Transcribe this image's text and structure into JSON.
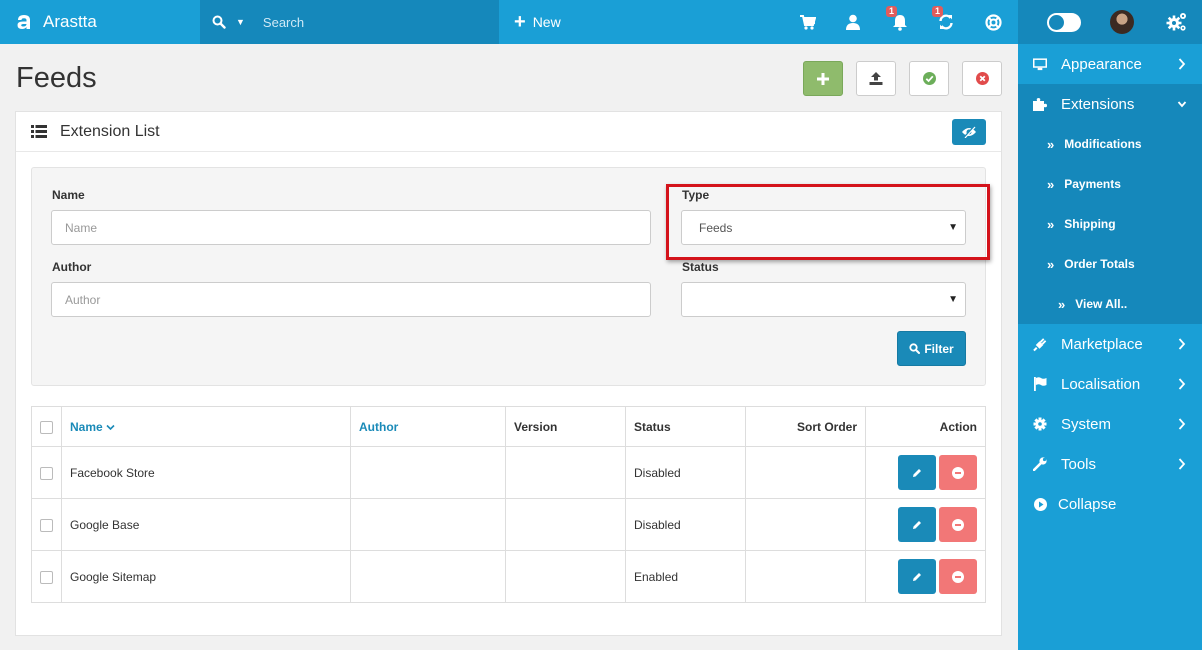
{
  "brand": {
    "name": "Arastta"
  },
  "topbar": {
    "search_placeholder": "Search",
    "new_label": "New",
    "notifications_count": "1",
    "updates_count": "1"
  },
  "page": {
    "title": "Feeds"
  },
  "panel": {
    "title": "Extension List"
  },
  "filter": {
    "name_label": "Name",
    "name_placeholder": "Name",
    "type_label": "Type",
    "type_value": "Feeds",
    "author_label": "Author",
    "author_placeholder": "Author",
    "status_label": "Status",
    "status_value": "",
    "filter_button": "Filter"
  },
  "table": {
    "headers": {
      "name": "Name",
      "author": "Author",
      "version": "Version",
      "status": "Status",
      "sort_order": "Sort Order",
      "action": "Action"
    },
    "rows": [
      {
        "name": "Facebook Store",
        "author": "",
        "version": "",
        "status": "Disabled",
        "sort_order": ""
      },
      {
        "name": "Google Base",
        "author": "",
        "version": "",
        "status": "Disabled",
        "sort_order": ""
      },
      {
        "name": "Google Sitemap",
        "author": "",
        "version": "",
        "status": "Enabled",
        "sort_order": ""
      }
    ]
  },
  "sidebar": {
    "appearance": "Appearance",
    "extensions": "Extensions",
    "sub": {
      "modifications": "Modifications",
      "payments": "Payments",
      "shipping": "Shipping",
      "order_totals": "Order Totals",
      "view_all": "View All.."
    },
    "marketplace": "Marketplace",
    "localisation": "Localisation",
    "system": "System",
    "tools": "Tools",
    "collapse": "Collapse"
  },
  "colors": {
    "primary": "#1a9fd6",
    "primary_dark": "#1588bb",
    "success": "#8fbb6c",
    "danger": "#f27777",
    "highlight": "#d4131b"
  }
}
